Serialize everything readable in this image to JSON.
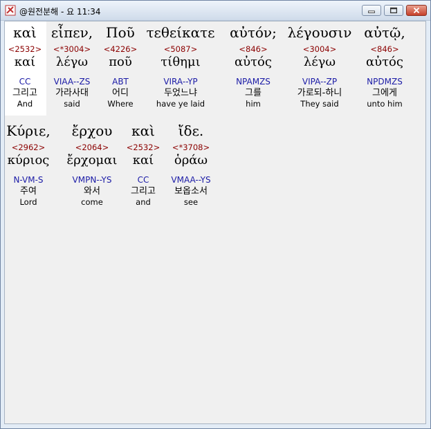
{
  "window": {
    "title": "@원전분해 - 요 11:34",
    "minimize_icon": "minimize-icon",
    "maximize_icon": "maximize-icon",
    "close_icon": "close-icon"
  },
  "rows": [
    {
      "words": [
        {
          "greek": "καὶ",
          "strong": "<2532>",
          "lemma": "καί",
          "morph": "CC",
          "korean": "그리고",
          "english": "And",
          "selected": true
        },
        {
          "greek": "εἶπεν,",
          "strong": "<*3004>",
          "lemma": "λέγω",
          "morph": "VIAA--ZS",
          "korean": "가라사대",
          "english": "said"
        },
        {
          "greek": "Ποῦ",
          "strong": "<4226>",
          "lemma": "ποῦ",
          "morph": "ABT",
          "korean": "어디",
          "english": "Where"
        },
        {
          "greek": "τεθείκατε",
          "strong": "<5087>",
          "lemma": "τίθημι",
          "morph": "VIRA--YP",
          "korean": "두었느냐",
          "english": "have ye laid"
        },
        {
          "greek": "αὐτόν;",
          "strong": "<846>",
          "lemma": "αὐτός",
          "morph": "NPAMZS",
          "korean": "그를",
          "english": "him"
        },
        {
          "greek": "λέγουσιν",
          "strong": "<3004>",
          "lemma": "λέγω",
          "morph": "VIPA--ZP",
          "korean": "가로되-하니",
          "english": "They said"
        },
        {
          "greek": "αὐτῷ,",
          "strong": "<846>",
          "lemma": "αὐτός",
          "morph": "NPDMZS",
          "korean": "그에게",
          "english": "unto him"
        }
      ]
    },
    {
      "words": [
        {
          "greek": "Κύριε,",
          "strong": "<2962>",
          "lemma": "κύριος",
          "morph": "N-VM-S",
          "korean": "주여",
          "english": "Lord"
        },
        {
          "greek": "ἔρχου",
          "strong": "<2064>",
          "lemma": "ἔρχομαι",
          "morph": "VMPN--YS",
          "korean": "와서",
          "english": "come"
        },
        {
          "greek": "καὶ",
          "strong": "<2532>",
          "lemma": "καί",
          "morph": "CC",
          "korean": "그리고",
          "english": "and"
        },
        {
          "greek": "ἴδε.",
          "strong": "<*3708>",
          "lemma": "ὁράω",
          "morph": "VMAA--YS",
          "korean": "보옵소서",
          "english": "see"
        }
      ]
    }
  ]
}
